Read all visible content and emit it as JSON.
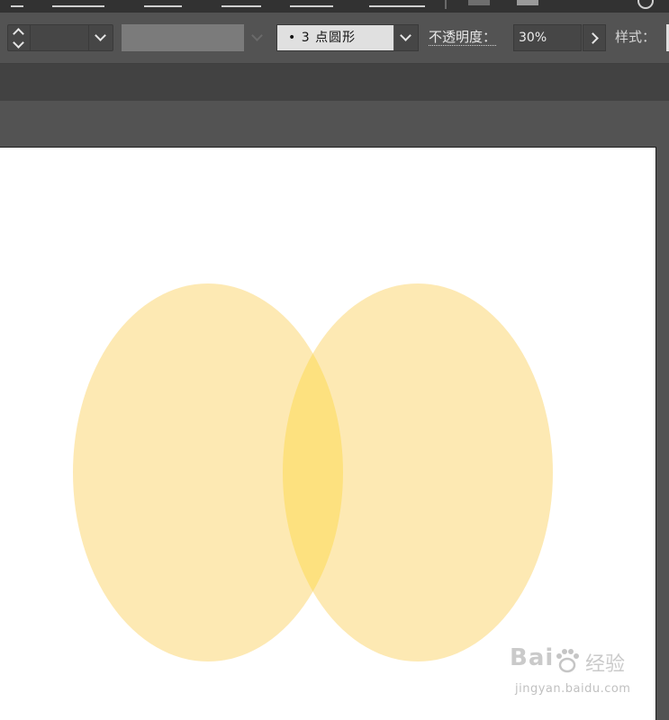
{
  "control_bar": {
    "stroke_weight_value": "",
    "stroke_color_hex": "#7b7b7b",
    "brush_definition": "•  3 点圆形",
    "opacity_label": "不透明度：",
    "opacity_value": "30%",
    "style_label": "样式："
  },
  "artwork": {
    "fill_color": "#fde9b3",
    "overlap_color": "#fde17f"
  },
  "watermark": {
    "logo_text": "Bai",
    "logo_cn": "经验",
    "url": "jingyan.baidu.com"
  }
}
